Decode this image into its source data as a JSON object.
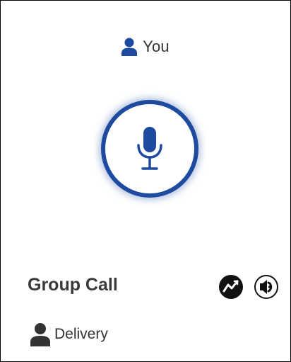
{
  "header": {
    "participant_label": "You",
    "participant_icon": "person-icon"
  },
  "mic": {
    "icon": "microphone-icon",
    "accent_color": "#1e4aa0"
  },
  "call": {
    "title": "Group Call",
    "actions": [
      {
        "icon": "activity-chart-icon"
      },
      {
        "icon": "speaker-icon"
      }
    ]
  },
  "group": {
    "label": "Delivery",
    "icon": "person-icon"
  }
}
